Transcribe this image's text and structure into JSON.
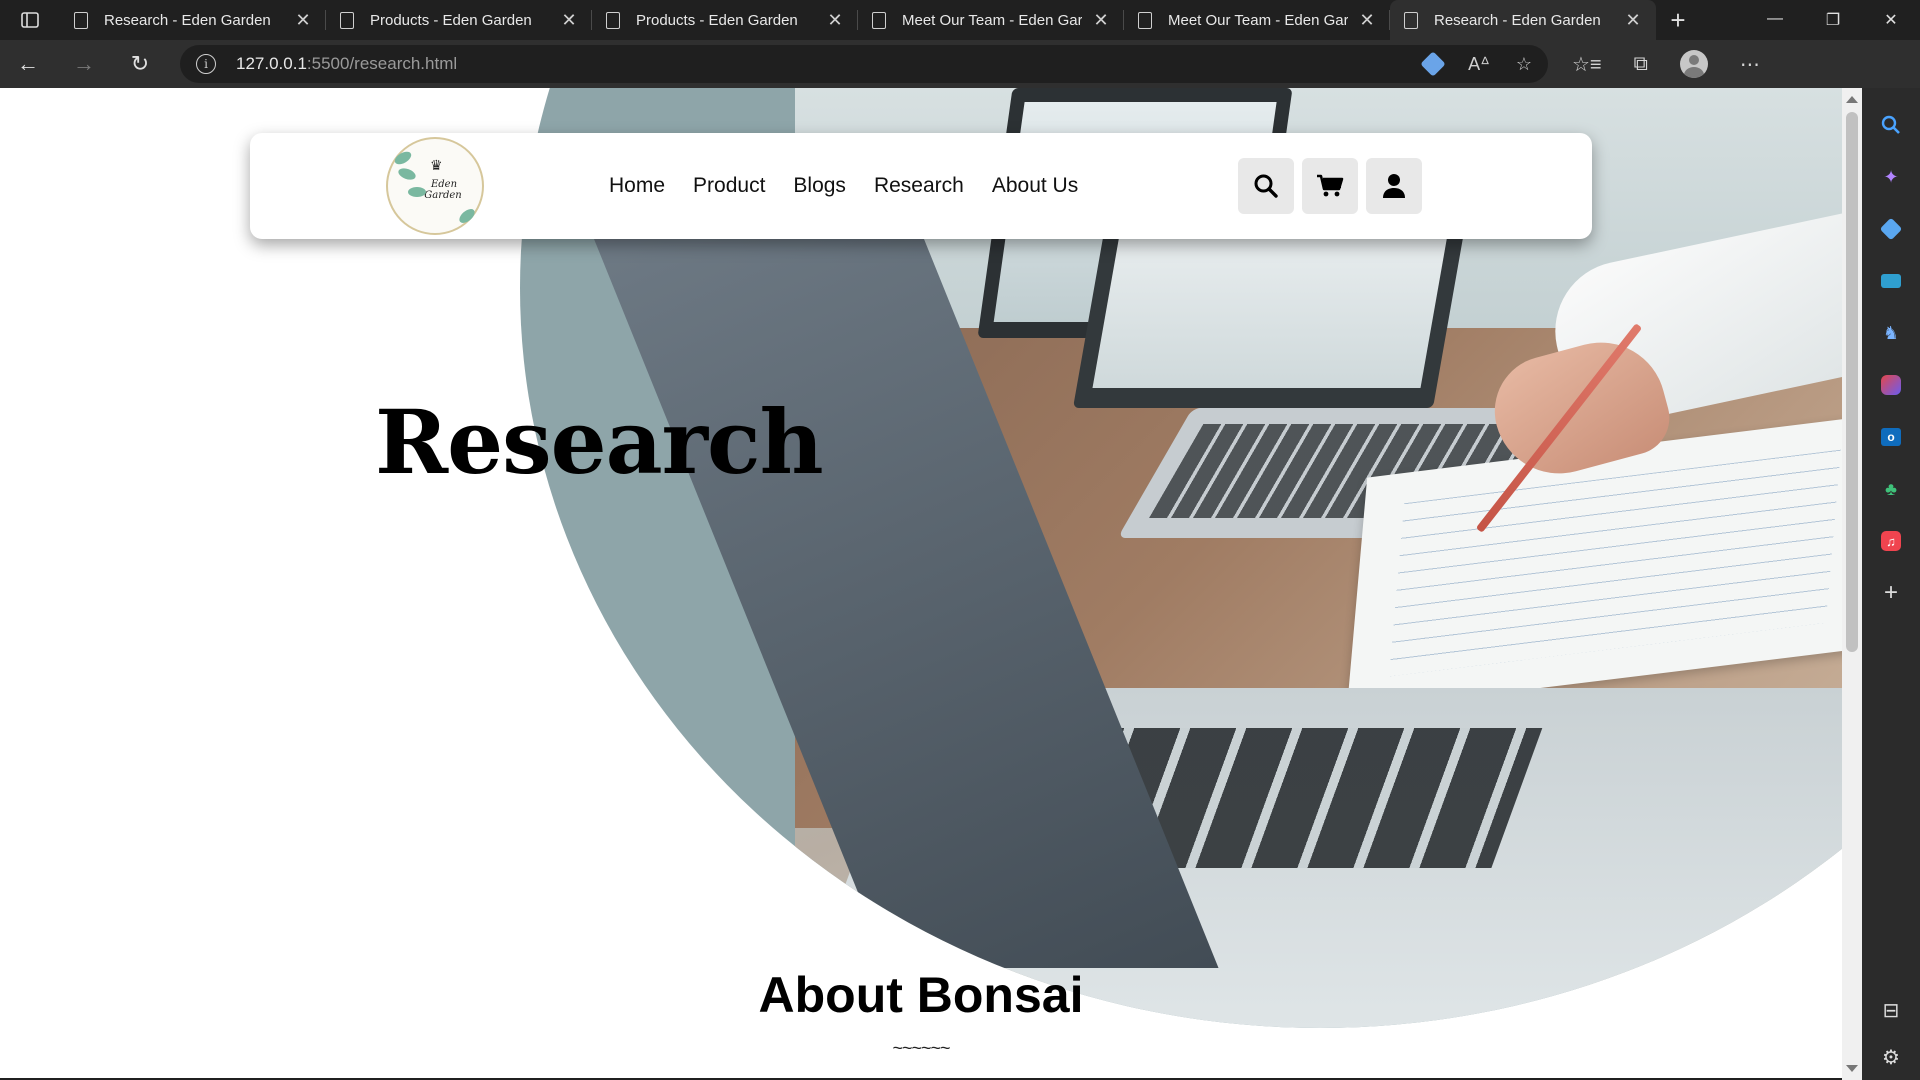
{
  "browser": {
    "tabs": [
      {
        "title": "Research - Eden Garden",
        "active": false
      },
      {
        "title": "Products - Eden Garden",
        "active": false
      },
      {
        "title": "Products - Eden Garden",
        "active": false
      },
      {
        "title": "Meet Our Team - Eden Garden",
        "active": false
      },
      {
        "title": "Meet Our Team - Eden Garden",
        "active": false
      },
      {
        "title": "Research - Eden Garden",
        "active": true
      }
    ],
    "new_tab": "+",
    "url_host": "127.0.0.1",
    "url_rest": ":5500/research.html",
    "window_controls": {
      "minimize": "—",
      "maximize": "❐",
      "close": "✕"
    },
    "nav": {
      "back": "←",
      "forward": "→",
      "reload": "↻"
    },
    "toolbar_icons": [
      "read-aloud-icon",
      "favorite-add-icon",
      "favorites-icon",
      "collections-icon",
      "profile-icon",
      "more-icon"
    ],
    "sidebar_icons": [
      "search-icon",
      "copilot-icon",
      "shopping-icon",
      "tools-icon",
      "games-icon",
      "office-icon",
      "outlook-icon",
      "tree-icon",
      "music-icon",
      "add-icon"
    ]
  },
  "site": {
    "logo": {
      "line1": "Eden",
      "line2": "Garden"
    },
    "menu": [
      {
        "label": "Home"
      },
      {
        "label": "Product"
      },
      {
        "label": "Blogs"
      },
      {
        "label": "Research"
      },
      {
        "label": "About Us"
      }
    ],
    "icons": [
      "search-icon",
      "cart-icon",
      "user-icon"
    ],
    "hero_title": "Research",
    "section_title": "About Bonsai",
    "section_divider": "~~~~~~"
  },
  "colors": {
    "chrome_bg": "#202020",
    "address_bg": "#2f2f2f",
    "page_bg": "#ffffff",
    "icon_btn_bg": "#e8e8e8"
  }
}
